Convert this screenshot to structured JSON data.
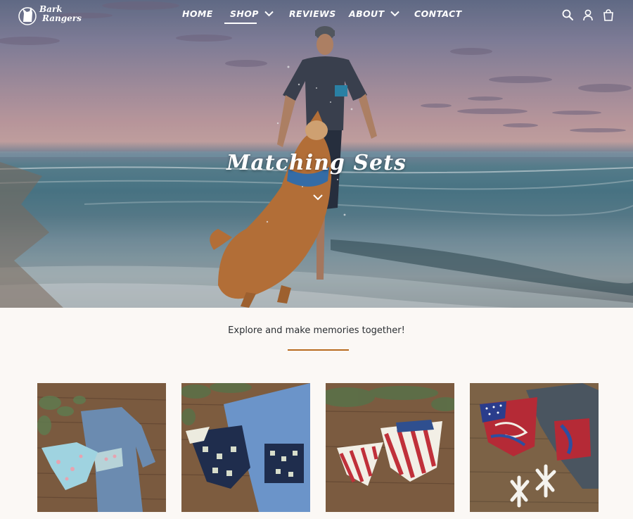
{
  "brand": {
    "name_line1": "Bark",
    "name_line2": "Rangers"
  },
  "nav": {
    "items": [
      {
        "label": "HOME",
        "has_dropdown": false,
        "active": false
      },
      {
        "label": "SHOP",
        "has_dropdown": true,
        "active": true
      },
      {
        "label": "REVIEWS",
        "has_dropdown": false,
        "active": false
      },
      {
        "label": "ABOUT",
        "has_dropdown": true,
        "active": false
      },
      {
        "label": "CONTACT",
        "has_dropdown": false,
        "active": false
      }
    ]
  },
  "header_icons": [
    "search-icon",
    "account-icon",
    "cart-icon"
  ],
  "hero": {
    "title": "Matching Sets",
    "scroll_icon": "chevron-down-icon"
  },
  "section": {
    "tagline": "Explore and make memories together!"
  },
  "colors": {
    "accent_rule": "#b86b1f",
    "page_bg": "#fbf8f5",
    "text": "#2b2f33"
  },
  "products": [
    {
      "image": "floral-bandana-and-blue-shirt"
    },
    {
      "image": "navy-aztec-bandana-and-blue-shirt"
    },
    {
      "image": "red-stripe-bandanas"
    },
    {
      "image": "patriotic-marble-bandana-and-shirt"
    }
  ]
}
